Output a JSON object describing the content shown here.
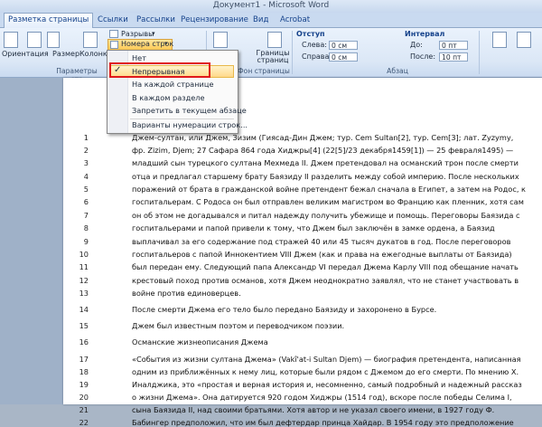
{
  "window": {
    "title": "Документ1 - Microsoft Word"
  },
  "tabs": [
    "Разметка страницы",
    "Ссылки",
    "Рассылки",
    "Рецензирование",
    "Вид",
    "Acrobat"
  ],
  "ribbon": {
    "breaks_label": "Разрывы",
    "line_numbers_label": "Номера строк",
    "orientation_label": "Ориентация",
    "size_label": "Размер",
    "columns_label": "Колонки",
    "page_setup_group": "Параметры стр",
    "page_bg_group": "Фон страницы",
    "page_borders_label": "Границы страниц",
    "indent_label": "Отступ",
    "spacing_label": "Интервал",
    "indent_left_label": "Слева:",
    "indent_right_label": "Справа:",
    "indent_left_value": "0 см",
    "indent_right_value": "0 см",
    "spacing_before_label": "До:",
    "spacing_after_label": "После:",
    "spacing_before_value": "0 пт",
    "spacing_after_value": "10 пт",
    "paragraph_group": "Абзац"
  },
  "menu": {
    "items": [
      "Нет",
      "Непрерывная",
      "На каждой странице",
      "В каждом разделе",
      "Запретить в текущем абзаце",
      "Варианты нумерации строк..."
    ],
    "checked": "Непрерывная"
  },
  "document": {
    "lines": [
      {
        "n": "1",
        "t": "Джем-султан, или Джем, Зизим (Гиясад-Дин Джем; тур. Cem Sultan[2], тур. Cem[3]; лат. Zyzymy,"
      },
      {
        "n": "2",
        "t": "фр. Zizim, Djem; 27 Сафара 864  года Хиджры[4] (22[5]/23 декабря1459[1]) — 25 февраля1495)  —"
      },
      {
        "n": "3",
        "t": "младший сын турецкого султана Мехмеда II. Джем претендовал на османский трон после смерти"
      },
      {
        "n": "4",
        "t": "отца и предлагал старшему брату Баязиду II разделить между собой империю. После нескольких"
      },
      {
        "n": "5",
        "t": "поражений от брата в гражданской войне претендент бежал сначала в Египет, а затем на Родос, к"
      },
      {
        "n": "6",
        "t": "госпитальерам. С Родоса он был отправлен великим магистром во Францию как пленник, хотя сам"
      },
      {
        "n": "7",
        "t": "он об этом не догадывался и питал надежду получить убежище и помощь. Переговоры Баязида с"
      },
      {
        "n": "8",
        "t": "госпитальерами и папой привели к тому, что Джем был заключён в замке ордена, а Баязид"
      },
      {
        "n": "9",
        "t": "выплачивал за его содержание под стражей 40  или 45 тысяч дукатов в год. После переговоров"
      },
      {
        "n": "10",
        "t": "госпитальеров с папой Иннокентием VIII Джем (как и права на ежегодные выплаты от Баязида)"
      },
      {
        "n": "11",
        "t": "был передан ему. Следующий папа Александр VI передал Джема Карлу VIII под обещание начать"
      },
      {
        "n": "12",
        "t": "крестовый поход против османов, хотя Джем неоднократно заявлял, что не станет участвовать в"
      },
      {
        "n": "13",
        "t": "войне против единоверцев."
      },
      {
        "n": "14",
        "t": "После смерти Джема его тело было передано Баязиду и захоронено в Бурсе."
      },
      {
        "n": "15",
        "t": "Джем был известным поэтом и переводчиком поэзии."
      },
      {
        "n": "16",
        "t": "Османские жизнеописания Джема"
      },
      {
        "n": "17",
        "t": "«События из жизни султана Джема» (Vakî'at-i Sultan Djem) — биография претендента, написанная"
      },
      {
        "n": "18",
        "t": "одним из приближённых к нему лиц, которые были рядом с Джемом до его смерти. По мнению Х."
      },
      {
        "n": "19",
        "t": "Иналджика, это «простая и верная история и, несомненно, самый подробный и надежный рассказ"
      },
      {
        "n": "20",
        "t": "о жизни Джема». Она датируется 920 годом Хиджры (1514 год), вскоре после победы Селима I,"
      },
      {
        "n": "21",
        "t": "сына Баязида II, над своими братьями. Хотя автор и не указал своего имени, в 1927 году Ф."
      },
      {
        "n": "22",
        "t": "Бабингер предположил, что им был дефтердар принца Хайдар. В 1954 году это предположение"
      }
    ]
  }
}
